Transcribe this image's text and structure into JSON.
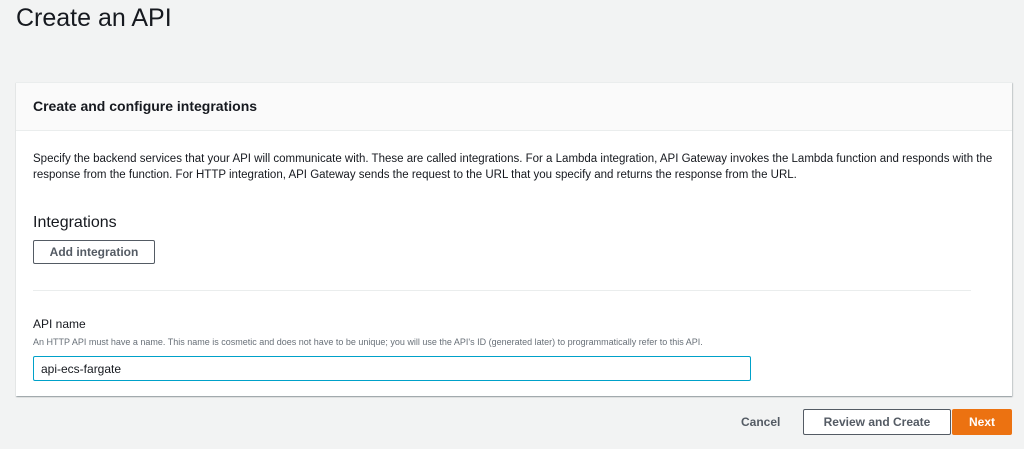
{
  "page_title": "Create an API",
  "card": {
    "header": "Create and configure integrations",
    "description": "Specify the backend services that your API will communicate with. These are called integrations. For a Lambda integration, API Gateway invokes the Lambda function and responds with the response from the function. For HTTP integration, API Gateway sends the request to the URL that you specify and returns the response from the URL.",
    "integrations_heading": "Integrations",
    "add_integration_label": "Add integration",
    "api_name_label": "API name",
    "api_name_help": "An HTTP API must have a name. This name is cosmetic and does not have to be unique; you will use the API's ID (generated later) to programmatically refer to this API.",
    "api_name_value": "api-ecs-fargate"
  },
  "footer": {
    "cancel_label": "Cancel",
    "review_label": "Review and Create",
    "next_label": "Next"
  },
  "colors": {
    "accent": "#ec7211",
    "focus": "#00a1c9"
  }
}
